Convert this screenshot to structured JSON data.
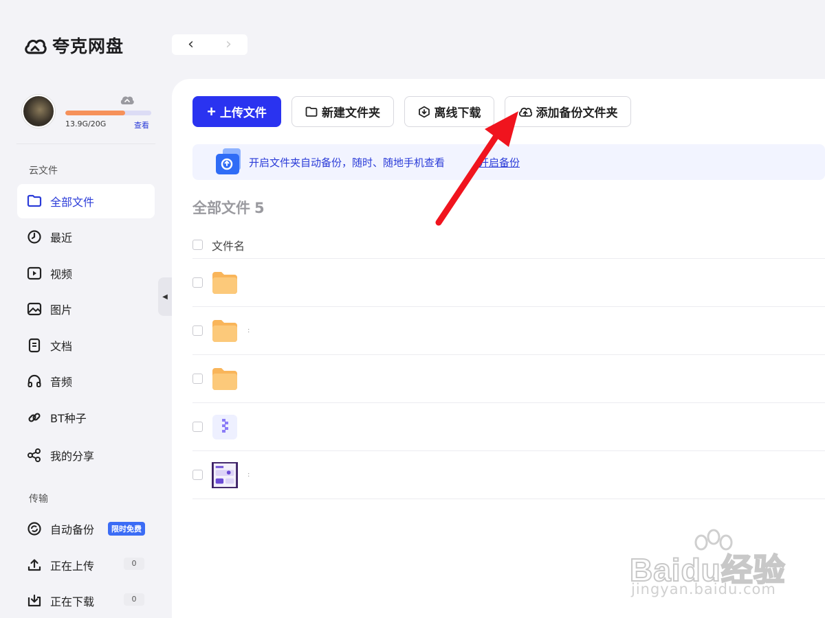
{
  "app": {
    "title": "夸克网盘"
  },
  "nav": {
    "back": "‹",
    "forward": "›"
  },
  "profile": {
    "storage_text": "13.9G/20G",
    "storage_link": "查看",
    "storage_used_fraction": 0.695
  },
  "sidebar": {
    "section_cloud": "云文件",
    "section_transfer": "传输",
    "items": [
      {
        "label": "全部文件",
        "icon": "folder-icon"
      },
      {
        "label": "最近",
        "icon": "clock-icon"
      },
      {
        "label": "视频",
        "icon": "video-icon"
      },
      {
        "label": "图片",
        "icon": "image-icon"
      },
      {
        "label": "文档",
        "icon": "document-icon"
      },
      {
        "label": "音频",
        "icon": "headphones-icon"
      },
      {
        "label": "BT种子",
        "icon": "link-icon"
      },
      {
        "label": "我的分享",
        "icon": "share-icon"
      }
    ],
    "transfer_items": [
      {
        "label": "自动备份",
        "icon": "backup-icon",
        "badge": "限时免费"
      },
      {
        "label": "正在上传",
        "icon": "upload-icon",
        "count": "0"
      },
      {
        "label": "正在下载",
        "icon": "download-icon",
        "count": "0"
      }
    ]
  },
  "toolbar": {
    "upload": "上传文件",
    "new_folder": "新建文件夹",
    "offline_download": "离线下载",
    "add_backup_folder": "添加备份文件夹"
  },
  "banner": {
    "text": "开启文件夹自动备份，随时、随地手机查看",
    "link": "开启备份"
  },
  "page": {
    "title": "全部文件",
    "count": "5"
  },
  "table": {
    "column_name": "文件名",
    "rows": [
      {
        "type": "folder",
        "icon": "folder-icon"
      },
      {
        "type": "folder",
        "icon": "folder-icon",
        "name": ":"
      },
      {
        "type": "folder",
        "icon": "folder-icon"
      },
      {
        "type": "archive",
        "icon": "zip-icon"
      },
      {
        "type": "image",
        "icon": "image-thumbnail",
        "name": ":"
      }
    ]
  },
  "colors": {
    "accent": "#2a33f0",
    "link": "#2a3bd8",
    "storage": "#f6915a",
    "folder": "#fcc97a"
  },
  "watermark": {
    "main": "Baidu经验",
    "sub": "jingyan.baidu.com"
  }
}
